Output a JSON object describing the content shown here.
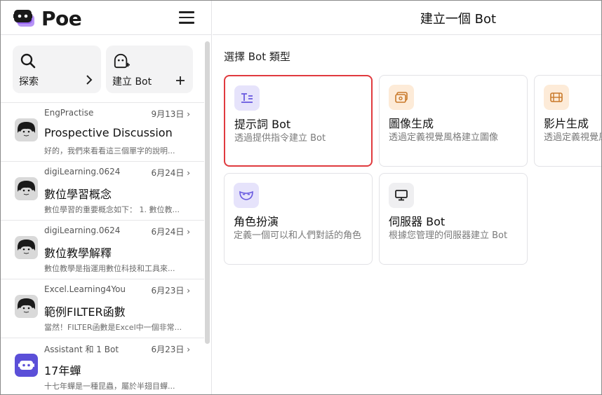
{
  "brand": {
    "name": "Poe"
  },
  "sidebar": {
    "quick_actions": [
      {
        "label": "探索",
        "side": "›"
      },
      {
        "label": "建立 Bot",
        "side": "+"
      }
    ],
    "conversations": [
      {
        "bot": "EngPractise",
        "date": "9月13日",
        "title": "Prospective Discussion",
        "snippet": "好的，我們來看看這三個單字的說明..."
      },
      {
        "bot": "digiLearning.0624",
        "date": "6月24日",
        "title": "數位學習概念",
        "snippet": "數位學習的重要概念如下： 1. 數位教..."
      },
      {
        "bot": "digiLearning.0624",
        "date": "6月24日",
        "title": "數位教學解釋",
        "snippet": "數位教學是指運用數位科技和工具來..."
      },
      {
        "bot": "Excel.Learning4You",
        "date": "6月23日",
        "title": "範例FILTER函數",
        "snippet": "當然！FILTER函數是Excel中一個非常..."
      },
      {
        "bot": "Assistant 和 1 Bot",
        "date": "6月23日",
        "title": "17年蟬",
        "snippet": "十七年蟬是一種昆蟲，屬於半翅目蟬..."
      }
    ]
  },
  "main": {
    "title": "建立一個 Bot",
    "section_label": "選擇 Bot 類型",
    "cards": [
      {
        "title": "提示詞 Bot",
        "desc": "透過提供指令建立 Bot",
        "icon": "prompt-icon",
        "color": "#e6e3fb"
      },
      {
        "title": "圖像生成",
        "desc": "透過定義視覺風格建立圖像",
        "icon": "image-icon",
        "color": "#fdebd8"
      },
      {
        "title": "影片生成",
        "desc": "透過定義視覺風格建立影片",
        "icon": "video-icon",
        "color": "#fdebd8"
      },
      {
        "title": "角色扮演",
        "desc": "定義一個可以和人們對話的角色",
        "icon": "mask-icon",
        "color": "#e6e3fb"
      },
      {
        "title": "伺服器 Bot",
        "desc": "根據您管理的伺服器建立 Bot",
        "icon": "monitor-icon",
        "color": "#efeff1"
      }
    ]
  }
}
